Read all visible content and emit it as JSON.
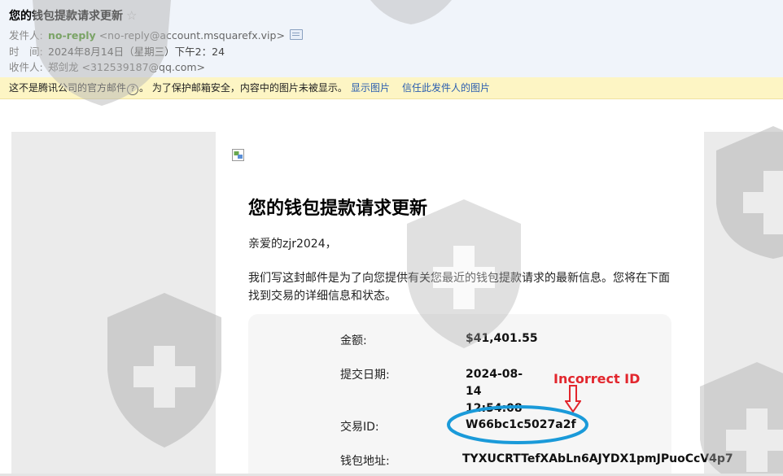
{
  "header": {
    "subject": "您的钱包提款请求更新",
    "star": "☆",
    "from_label": "发件人:",
    "from_name": "no-reply",
    "from_addr": "<no-reply@account.msquarefx.vip>",
    "time_label": "时　间:",
    "time_value": "2024年8月14日（星期三）下午2：24",
    "to_label": "收件人:",
    "to_value": "郑剑龙 <312539187@qq.com>"
  },
  "notice": {
    "text_before": "这不是腾讯公司的官方邮件",
    "help_icon": "?",
    "text_after": "。 为了保护邮箱安全，内容中的图片未被显示。",
    "link_show_images": "显示图片",
    "link_trust_sender": "信任此发件人的图片"
  },
  "mail": {
    "title": "您的钱包提款请求更新",
    "greeting": "亲爱的zjr2024，",
    "paragraph": "我们写这封邮件是为了向您提供有关您最近的钱包提款请求的最新信息。您将在下面找到交易的详细信息和状态。",
    "rows": [
      {
        "label": "金额:",
        "value": "$41,401.55"
      },
      {
        "label": "提交日期:",
        "value": "2024-08-14 12:54:08"
      },
      {
        "label": "交易ID:",
        "value": "W66bc1c5027a2f"
      },
      {
        "label": "钱包地址:",
        "value": "TYXUCRTTefXAbLn6AJYDX1pmJPuoCcV4p7"
      }
    ]
  },
  "annotation": {
    "text": "Incorrect ID",
    "color": "#e2262d",
    "ellipse_color": "#1a9ad9"
  }
}
